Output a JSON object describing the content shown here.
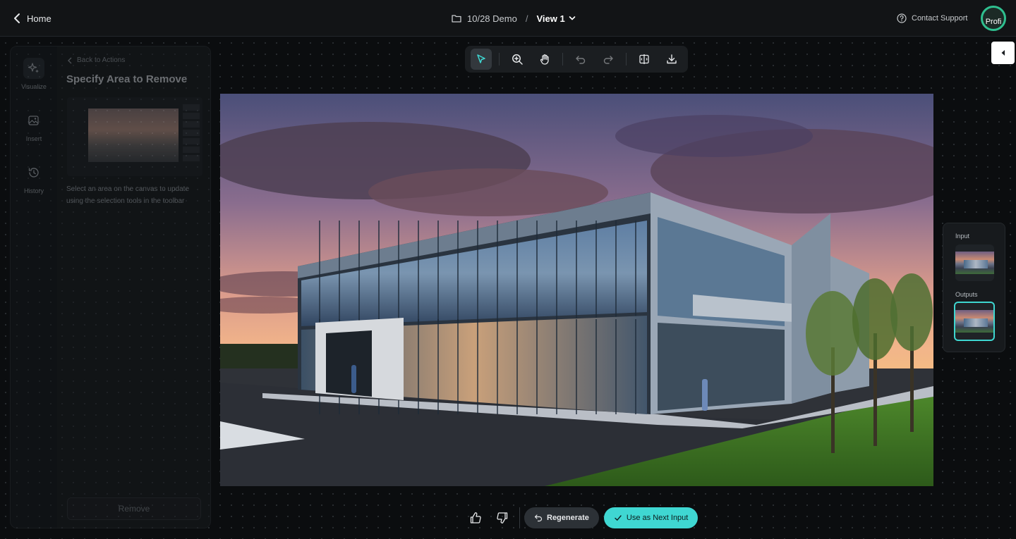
{
  "header": {
    "home_label": "Home",
    "project": "10/28 Demo",
    "separator": "/",
    "view": "View 1",
    "support": "Contact Support",
    "avatar_text": "Profi"
  },
  "left_panel": {
    "rail": [
      {
        "label": "Visualize",
        "icon": "sparkle-icon"
      },
      {
        "label": "Insert",
        "icon": "image-plus-icon"
      },
      {
        "label": "History",
        "icon": "history-icon"
      }
    ],
    "back_label": "Back to Actions",
    "title": "Specify Area to Remove",
    "helper": "Select an area on the canvas to update using the selection tools in the toolbar",
    "remove_label": "Remove"
  },
  "toolbar": {
    "tools": [
      "select-icon",
      "zoom-in-icon",
      "hand-icon",
      "undo-icon",
      "redo-icon",
      "compare-icon",
      "download-icon"
    ],
    "active": "select-icon"
  },
  "io_panel": {
    "input_label": "Input",
    "outputs_label": "Outputs"
  },
  "actions": {
    "regenerate": "Regenerate",
    "use_next": "Use as Next Input"
  },
  "colors": {
    "accent": "#3fd7d2",
    "avatar_ring": "#2fbf8f",
    "background": "#0c0e10"
  }
}
